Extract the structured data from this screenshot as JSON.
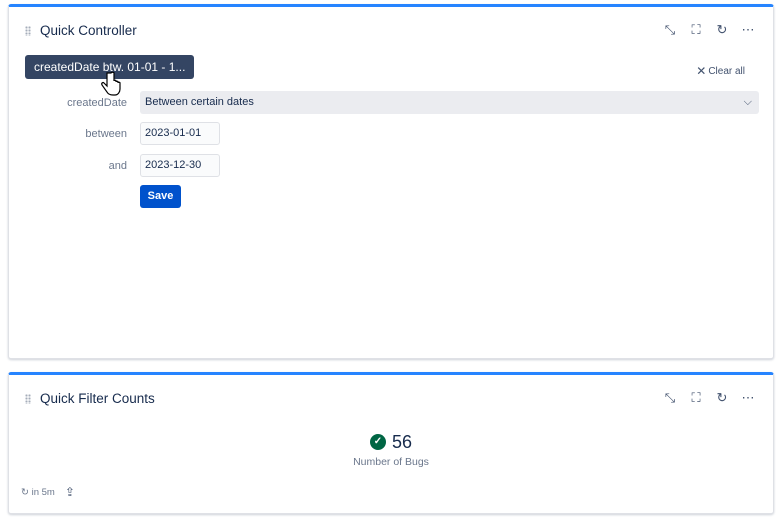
{
  "controller": {
    "title": "Quick Controller",
    "chip": "createdDate btw. 01-01 - 1...",
    "clear_all": "Clear all",
    "field_label": "createdDate",
    "field_value": "Between certain dates",
    "between_label": "between",
    "between_value": "2023-01-01",
    "and_label": "and",
    "and_value": "2023-12-30",
    "save": "Save"
  },
  "counts": {
    "title": "Quick Filter Counts",
    "value": "56",
    "metric_label": "Number of Bugs",
    "refresh": "in 5m"
  },
  "colors": {
    "accent": "#2684ff",
    "chip": "#344563",
    "primary": "#0052cc",
    "success": "#006644"
  }
}
